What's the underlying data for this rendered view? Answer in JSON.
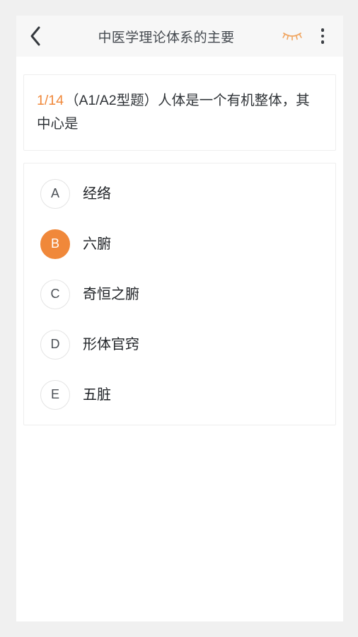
{
  "header": {
    "back_icon": "chevron-left-icon",
    "title": "中医学理论体系的主要",
    "eye_icon": "eye-closed-icon",
    "more_icon": "more-vertical-icon"
  },
  "question": {
    "index_label": "1/14",
    "text": "（A1/A2型题）人体是一个有机整体，其中心是"
  },
  "options": [
    {
      "key": "A",
      "label": "经络",
      "selected": false
    },
    {
      "key": "B",
      "label": "六腑",
      "selected": true
    },
    {
      "key": "C",
      "label": "奇恒之腑",
      "selected": false
    },
    {
      "key": "D",
      "label": "形体官窍",
      "selected": false
    },
    {
      "key": "E",
      "label": "五脏",
      "selected": false
    }
  ],
  "colors": {
    "accent": "#f0883a",
    "page_background": "#f0f0f0",
    "header_background": "#f7f7f7",
    "card_background": "#ffffff",
    "card_border": "#eeeeee",
    "text_primary": "#1f2226",
    "text_title": "#44494f"
  }
}
